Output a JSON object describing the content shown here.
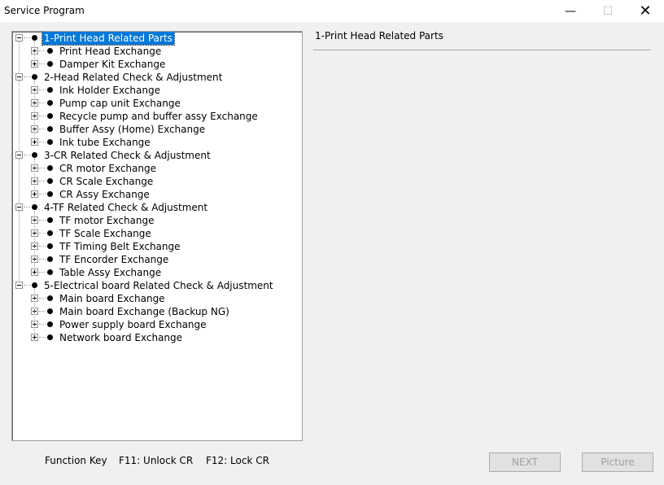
{
  "window": {
    "title": "Service Program",
    "minimize_glyph": "—",
    "maximize_glyph": "☐",
    "close_glyph": "✕"
  },
  "tree": [
    {
      "label": "1-Print Head Related Parts",
      "level": 0,
      "expanded": true,
      "selected": true
    },
    {
      "label": "Print Head Exchange",
      "level": 1
    },
    {
      "label": "Damper Kit Exchange",
      "level": 1
    },
    {
      "label": "2-Head Related Check & Adjustment",
      "level": 0,
      "expanded": true
    },
    {
      "label": "Ink Holder Exchange",
      "level": 1
    },
    {
      "label": "Pump cap unit Exchange",
      "level": 1
    },
    {
      "label": "Recycle pump and buffer assy Exchange",
      "level": 1
    },
    {
      "label": "Buffer Assy (Home) Exchange",
      "level": 1
    },
    {
      "label": "Ink tube Exchange",
      "level": 1
    },
    {
      "label": "3-CR Related Check & Adjustment",
      "level": 0,
      "expanded": true
    },
    {
      "label": "CR motor Exchange",
      "level": 1
    },
    {
      "label": "CR Scale Exchange",
      "level": 1
    },
    {
      "label": "CR Assy Exchange",
      "level": 1
    },
    {
      "label": "4-TF Related Check & Adjustment",
      "level": 0,
      "expanded": true
    },
    {
      "label": "TF motor Exchange",
      "level": 1
    },
    {
      "label": "TF Scale Exchange",
      "level": 1
    },
    {
      "label": "TF Timing Belt Exchange",
      "level": 1
    },
    {
      "label": "TF Encorder Exchange",
      "level": 1
    },
    {
      "label": "Table Assy Exchange",
      "level": 1
    },
    {
      "label": "5-Electrical board Related Check & Adjustment",
      "level": 0,
      "expanded": true
    },
    {
      "label": "Main board Exchange",
      "level": 1
    },
    {
      "label": "Main board Exchange (Backup NG)",
      "level": 1
    },
    {
      "label": "Power supply board Exchange",
      "level": 1
    },
    {
      "label": "Network board Exchange",
      "level": 1
    }
  ],
  "detail": {
    "title": "1-Print Head Related Parts"
  },
  "footer": {
    "function_key_label": "Function Key",
    "f11_label": "F11: Unlock CR",
    "f12_label": "F12: Lock CR",
    "next_label": "NEXT",
    "picture_label": "Picture"
  }
}
